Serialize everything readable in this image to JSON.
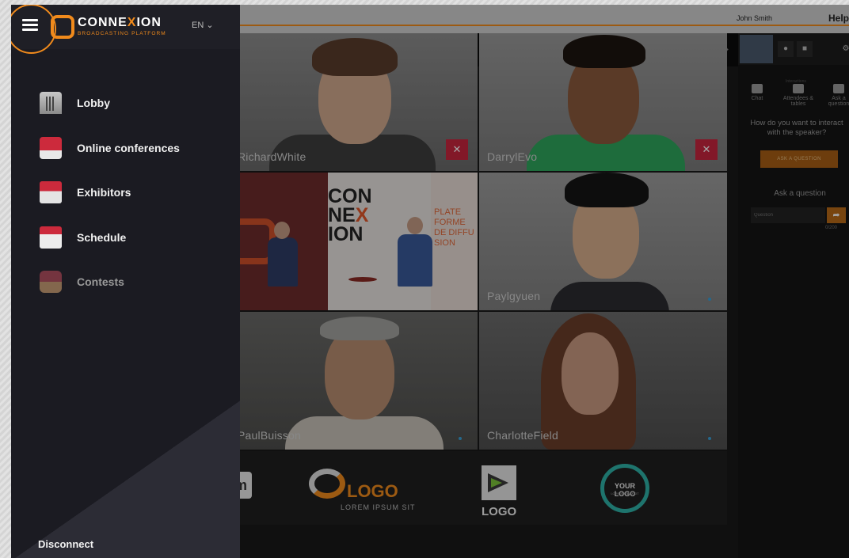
{
  "topbar": {
    "user_name": "John Smith",
    "help_label": "Help"
  },
  "brand": {
    "name_part1": "CONNE",
    "name_x": "X",
    "name_part2": "ION",
    "subtitle": "BROADCASTING PLATFORM",
    "language": "EN"
  },
  "sidebar": {
    "items": [
      {
        "label": "Lobby",
        "icon": "building-icon",
        "enabled": true
      },
      {
        "label": "Online conferences",
        "icon": "speaker-podium-icon",
        "enabled": true
      },
      {
        "label": "Exhibitors",
        "icon": "booth-icon",
        "enabled": true
      },
      {
        "label": "Schedule",
        "icon": "calendar-icon",
        "enabled": true
      },
      {
        "label": "Contests",
        "icon": "gift-icon",
        "enabled": false
      }
    ],
    "disconnect_label": "Disconnect"
  },
  "participants": [
    {
      "name": "RichardWhite",
      "muted": true
    },
    {
      "name": "DarrylEvo",
      "muted": true
    },
    {
      "name": "",
      "muted": false
    },
    {
      "name": "Paylgyuen",
      "muted": false
    },
    {
      "name": "PaulBuisson",
      "muted": false
    },
    {
      "name": "CharlotteField",
      "muted": false
    }
  ],
  "conference_stage": {
    "title_part1": "CON",
    "title_part2": "NE",
    "title_x": "X",
    "title_part3": "ION",
    "side_text": "PLATE FORME DE DIFFU SION"
  },
  "sponsors": {
    "logo_m": "m",
    "logo1_text": "LOGO",
    "logo1_sub": "LOREM IPSUM SIT",
    "logo2_text": "LOGO",
    "logo3_text": "YOUR LOGO",
    "logo3_sub": "LOREM IPSUM SIT"
  },
  "right_panel": {
    "tabs_heading": "Interactions",
    "tabs": [
      "Chat",
      "Attendees & tables",
      "Ask a question"
    ],
    "question_prompt": "How do you want to interact with the speaker?",
    "ask_button": "ASK A QUESTION",
    "ask_title": "Ask a question",
    "input_placeholder": "Question",
    "char_count": "0/200"
  },
  "colors": {
    "accent": "#f08a1c",
    "mute_red": "#c8253e",
    "sidebar_bg": "#1b1b22"
  }
}
